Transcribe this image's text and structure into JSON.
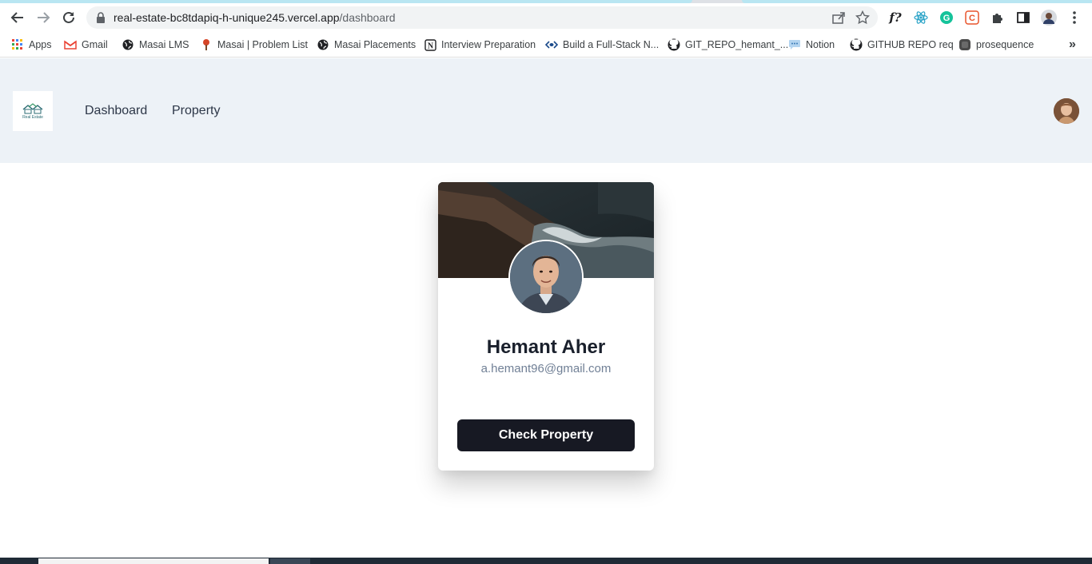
{
  "browser": {
    "url_domain": "real-estate-bc8tdapiq-h-unique245.vercel.app",
    "url_path": "/dashboard",
    "bookmarks": [
      {
        "label": "Apps",
        "icon": "apps-grid-icon"
      },
      {
        "label": "Gmail",
        "icon": "gmail-icon"
      },
      {
        "label": "Masai LMS",
        "icon": "globe-icon"
      },
      {
        "label": "Masai | Problem List",
        "icon": "masai-icon"
      },
      {
        "label": "Masai Placements",
        "icon": "globe-icon"
      },
      {
        "label": "Interview Preparation",
        "icon": "notion-icon"
      },
      {
        "label": "Build a Full-Stack N...",
        "icon": "code-icon"
      },
      {
        "label": "GIT_REPO_hemant_...",
        "icon": "github-icon"
      },
      {
        "label": "Notion",
        "icon": "chat-icon"
      },
      {
        "label": "GITHUB REPO req",
        "icon": "github-icon"
      },
      {
        "label": "prosequence",
        "icon": "prosequence-icon"
      }
    ],
    "more_bookmarks": "»"
  },
  "header": {
    "logo_text": "Real Estate",
    "nav": {
      "dashboard": "Dashboard",
      "property": "Property"
    }
  },
  "profile": {
    "name": "Hemant Aher",
    "email": "a.hemant96@gmail.com",
    "button_label": "Check Property"
  },
  "colors": {
    "header_bg": "#edf2f7",
    "button_bg": "#171923",
    "email_text": "#718096"
  }
}
